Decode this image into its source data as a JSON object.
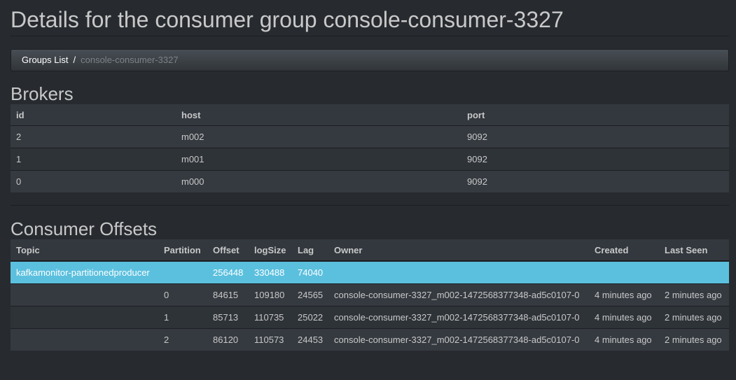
{
  "page": {
    "title": "Details for the consumer group console-consumer-3327"
  },
  "breadcrumb": {
    "link_label": "Groups List",
    "separator": "/",
    "active_label": "console-consumer-3327"
  },
  "brokers": {
    "heading": "Brokers",
    "columns": [
      "id",
      "host",
      "port"
    ],
    "rows": [
      [
        "2",
        "m002",
        "9092"
      ],
      [
        "1",
        "m001",
        "9092"
      ],
      [
        "0",
        "m000",
        "9092"
      ]
    ]
  },
  "offsets": {
    "heading": "Consumer Offsets",
    "columns": [
      "Topic",
      "Partition",
      "Offset",
      "logSize",
      "Lag",
      "Owner",
      "Created",
      "Last Seen"
    ],
    "topic_row": [
      "kafkamonitor-partitionedproducer",
      "",
      "256448",
      "330488",
      "74040",
      "",
      "",
      ""
    ],
    "rows": [
      [
        "",
        "0",
        "84615",
        "109180",
        "24565",
        "console-consumer-3327_m002-1472568377348-ad5c0107-0",
        "4 minutes ago",
        "2 minutes ago"
      ],
      [
        "",
        "1",
        "85713",
        "110735",
        "25022",
        "console-consumer-3327_m002-1472568377348-ad5c0107-0",
        "4 minutes ago",
        "2 minutes ago"
      ],
      [
        "",
        "2",
        "86120",
        "110573",
        "24453",
        "console-consumer-3327_m002-1472568377348-ad5c0107-0",
        "4 minutes ago",
        "2 minutes ago"
      ]
    ]
  },
  "colors": {
    "background": "#272b30",
    "highlight_row": "#5bc0de",
    "text": "#c8c8c8"
  }
}
